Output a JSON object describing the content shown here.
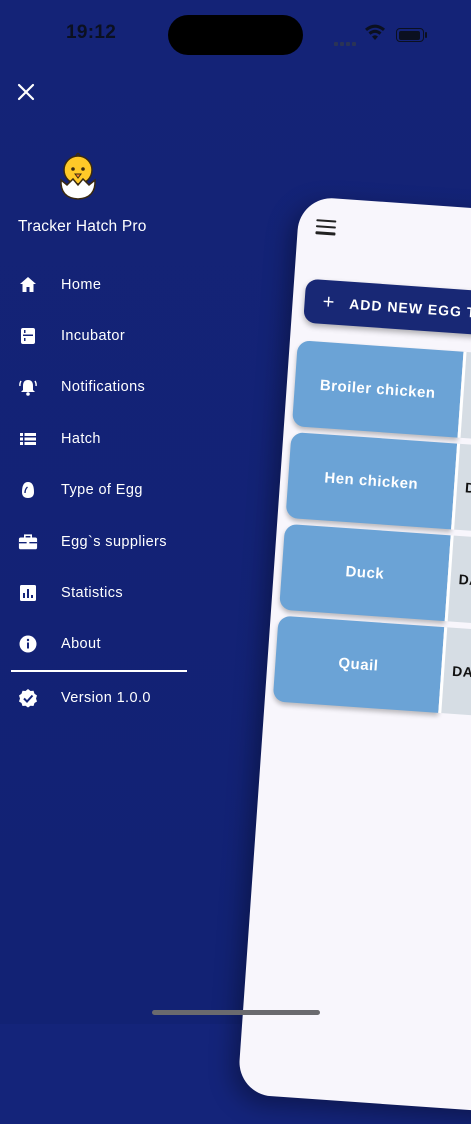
{
  "status_bar": {
    "time": "19:12"
  },
  "drawer": {
    "title": "Tracker Hatch Pro",
    "items": [
      {
        "label": "Home",
        "icon": "home-icon"
      },
      {
        "label": "Incubator",
        "icon": "incubator-icon"
      },
      {
        "label": "Notifications",
        "icon": "bell-icon"
      },
      {
        "label": "Hatch",
        "icon": "list-icon"
      },
      {
        "label": "Type of Egg",
        "icon": "egg-icon"
      },
      {
        "label": "Egg`s suppliers",
        "icon": "briefcase-icon"
      },
      {
        "label": "Statistics",
        "icon": "bar-chart-icon"
      },
      {
        "label": "About",
        "icon": "info-icon"
      }
    ],
    "version_label": "Version 1.0.0"
  },
  "main": {
    "add_button_label": "ADD NEW EGG T",
    "egg_types": [
      {
        "name": "Broiler chicken",
        "days": ""
      },
      {
        "name": "Hen chicken",
        "days": "D"
      },
      {
        "name": "Duck",
        "days": "DA"
      },
      {
        "name": "Quail",
        "days": "DA"
      }
    ]
  },
  "colors": {
    "drawer_background": "#14247a",
    "card_blue": "#6ba3d6",
    "button_navy": "#182875",
    "screen_background": "#f8f6fc"
  }
}
